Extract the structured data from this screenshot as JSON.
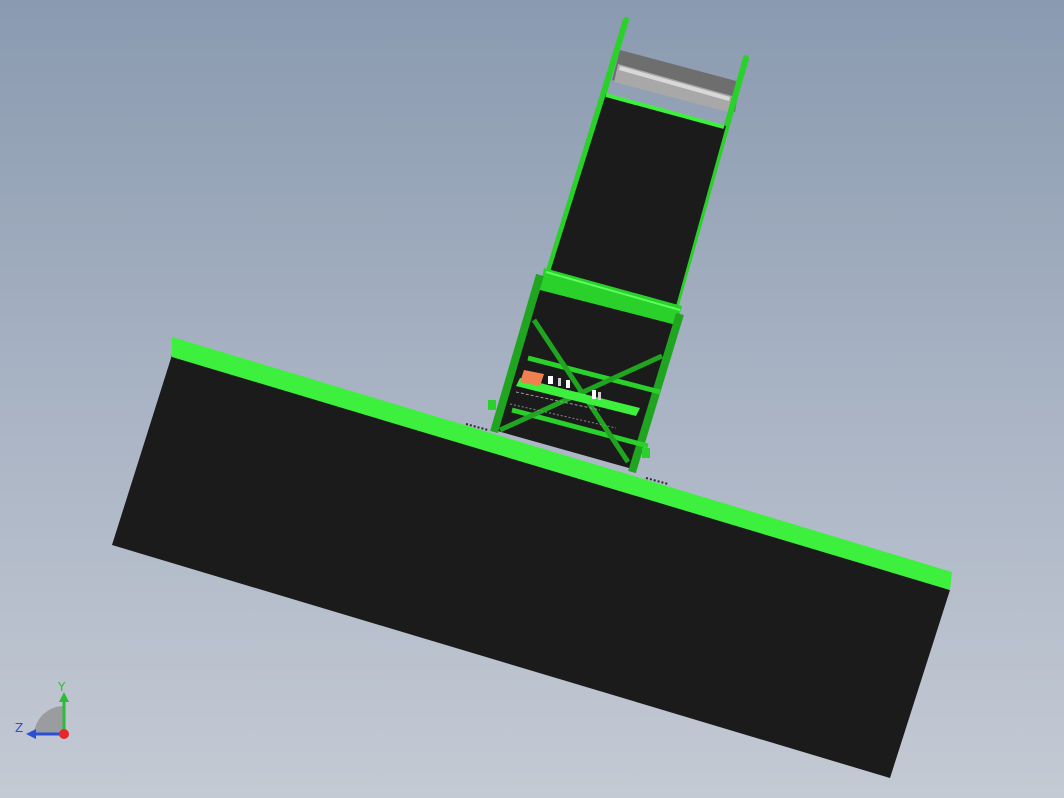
{
  "viewport": {
    "background_top": "#8a9ab0",
    "background_bottom": "#c4cad4"
  },
  "model": {
    "part_color": "#1a1a1a",
    "accent_color": "#3df03d",
    "frame_color": "#1fa51f",
    "roller_color": "#a0a0a0"
  },
  "triad": {
    "y_label": "Y",
    "z_label": "Z",
    "y_color": "#2dbb3a",
    "z_color": "#2a4fd6",
    "origin_color": "#e8262a"
  }
}
